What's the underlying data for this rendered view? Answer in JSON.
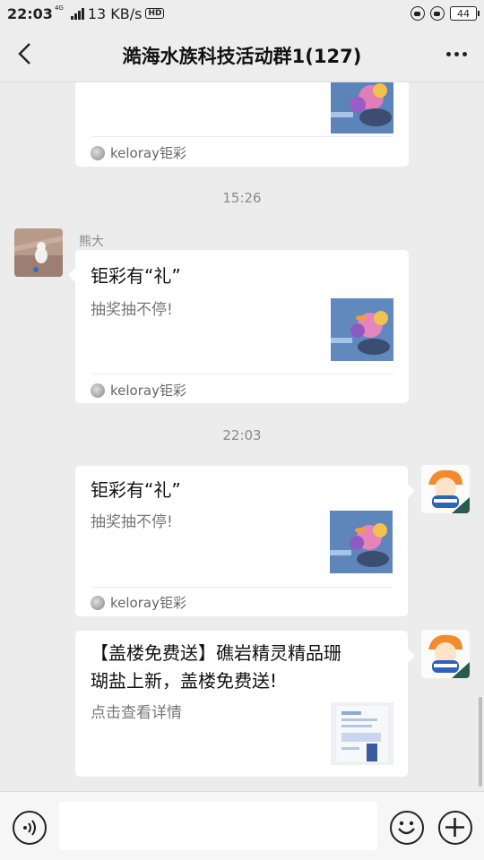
{
  "status_bar": {
    "time": "22:03",
    "network_type": "4G",
    "speed": "13 KB/s",
    "hd": "HD",
    "battery": "44"
  },
  "nav": {
    "title": "澔海水族科技活动群1(127)",
    "back_icon": "chevron-left-icon",
    "more_icon": "more-dots-icon"
  },
  "messages": [
    {
      "type": "link-card",
      "side": "left",
      "source": "keloray钜彩"
    },
    {
      "type": "timestamp",
      "text": "15:26"
    },
    {
      "type": "link-card",
      "side": "left",
      "sender": "熊大",
      "title": "钜彩有“礼”",
      "desc": "抽奖抽不停!",
      "source": "keloray钜彩"
    },
    {
      "type": "timestamp",
      "text": "22:03"
    },
    {
      "type": "link-card",
      "side": "right",
      "title": "钜彩有“礼”",
      "desc": "抽奖抽不停!",
      "source": "keloray钜彩"
    },
    {
      "type": "link-card",
      "side": "right",
      "title_line1": "【盖楼免费送】礁岩精灵精品珊",
      "title_line2": "瑚盐上新，盖楼免费送!",
      "desc": "点击查看详情"
    }
  ],
  "input_bar": {
    "voice_icon": "voice-icon",
    "emoji_icon": "emoji-icon",
    "plus_icon": "plus-icon",
    "placeholder": ""
  },
  "colors": {
    "background": "#ececec",
    "bubble": "#ffffff",
    "bar": "#ededed"
  }
}
